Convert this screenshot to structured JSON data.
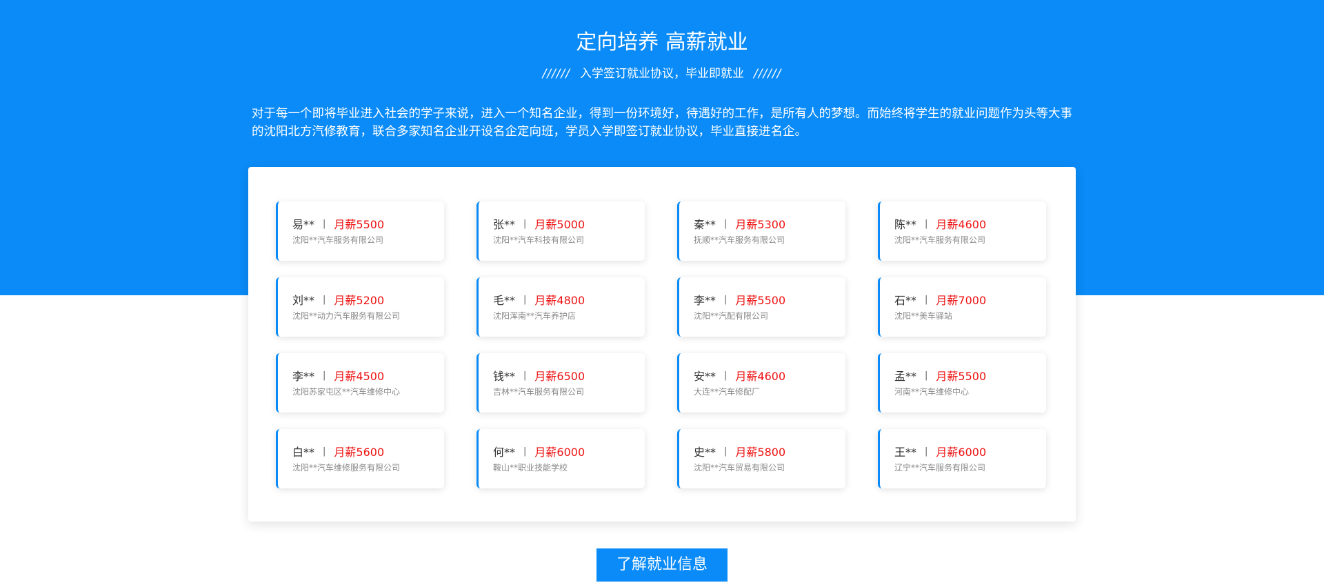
{
  "hero": {
    "title": "定向培养 高薪就业",
    "subtitle_slashes_left": "//////",
    "subtitle_text": "入学签订就业协议，毕业即就业",
    "subtitle_slashes_right": "//////",
    "intro": "对于每一个即将毕业进入社会的学子来说，进入一个知名企业，得到一份环境好，待遇好的工作，是所有人的梦想。而始终将学生的就业问题作为头等大事的沈阳北方汽修教育，联合多家知名企业开设名企定向班，学员入学即签订就业协议，毕业直接进名企。"
  },
  "jobs": [
    {
      "name": "易**",
      "separator": "|",
      "salary": "月薪5500",
      "company": "沈阳**汽车服务有限公司"
    },
    {
      "name": "张**",
      "separator": "|",
      "salary": "月薪5000",
      "company": "沈阳**汽车科技有限公司"
    },
    {
      "name": "秦**",
      "separator": "|",
      "salary": "月薪5300",
      "company": "抚顺**汽车服务有限公司"
    },
    {
      "name": "陈**",
      "separator": "|",
      "salary": "月薪4600",
      "company": "沈阳**汽车服务有限公司"
    },
    {
      "name": "刘**",
      "separator": "|",
      "salary": "月薪5200",
      "company": "沈阳**动力汽车服务有限公司"
    },
    {
      "name": "毛**",
      "separator": "|",
      "salary": "月薪4800",
      "company": "沈阳浑南**汽车养护店"
    },
    {
      "name": "李**",
      "separator": "|",
      "salary": "月薪5500",
      "company": "沈阳**汽配有限公司"
    },
    {
      "name": "石**",
      "separator": "|",
      "salary": "月薪7000",
      "company": "沈阳**美车驿站"
    },
    {
      "name": "李**",
      "separator": "|",
      "salary": "月薪4500",
      "company": "沈阳苏家屯区**汽车维修中心"
    },
    {
      "name": "钱**",
      "separator": "|",
      "salary": "月薪6500",
      "company": "吉林**汽车服务有限公司"
    },
    {
      "name": "安**",
      "separator": "|",
      "salary": "月薪4600",
      "company": "大连**汽车修配厂"
    },
    {
      "name": "孟**",
      "separator": "|",
      "salary": "月薪5500",
      "company": "河南**汽车维修中心"
    },
    {
      "name": "白**",
      "separator": "|",
      "salary": "月薪5600",
      "company": "沈阳**汽车维修服务有限公司"
    },
    {
      "name": "何**",
      "separator": "|",
      "salary": "月薪6000",
      "company": "鞍山**职业技能学校"
    },
    {
      "name": "史**",
      "separator": "|",
      "salary": "月薪5800",
      "company": "沈阳**汽车贸易有限公司"
    },
    {
      "name": "王**",
      "separator": "|",
      "salary": "月薪6000",
      "company": "辽宁**汽车服务有限公司"
    }
  ],
  "cta": {
    "label": "了解就业信息"
  },
  "colors": {
    "brand_blue": "#0a8bf7",
    "salary_red": "#ee1111"
  }
}
